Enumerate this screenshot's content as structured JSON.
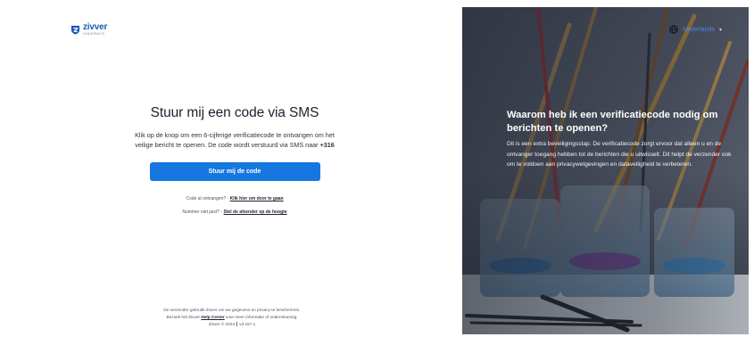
{
  "logo": {
    "name": "zivver",
    "sub": "ONDERWIJS",
    "icon": "zivver-shield-icon",
    "brand_color": "#1a5bb8"
  },
  "form": {
    "title": "Stuur mij een code via SMS",
    "description": "Klik op de knop om een 6-cijferige verificatiecode te ontvangen om het veilige bericht te openen. De code wordt verstuurd via SMS naar",
    "phone": "+316",
    "button_label": "Stuur mij de code",
    "button_color": "#1677e0",
    "code_received_text": "Code al ontvangen?",
    "code_received_link": "Klik hier om door te gaan",
    "wrong_number_text": "Nummer niet juist?",
    "wrong_number_link": "Stel de afzender op de hoogte"
  },
  "footer": {
    "line1": "De verzender gebruikt Zivver om uw gegevens en privacy te beschermen.",
    "line2_before": "Bezoek het Zivver",
    "help_center": "Help Center",
    "line2_after": "voor meer informatie of ondersteuning.",
    "copyright": "Zivver © 2024",
    "version": "v3.157.1"
  },
  "language": {
    "label": "Nederlands",
    "icon": "globe-icon",
    "chevron": "chevron-down-icon"
  },
  "panel": {
    "title": "Waarom heb ik een verificatiecode nodig om berichten te openen?",
    "body": "Dit is een extra beveiligingsstap. De verificatiecode zorgt ervoor dat alleen u en de ontvanger toegang hebben tot de berichten die u uitwisselt. Dit helpt de verzender ook om te voldoen aan privacywetgevingen en dataveiligheid te verbeteren."
  }
}
